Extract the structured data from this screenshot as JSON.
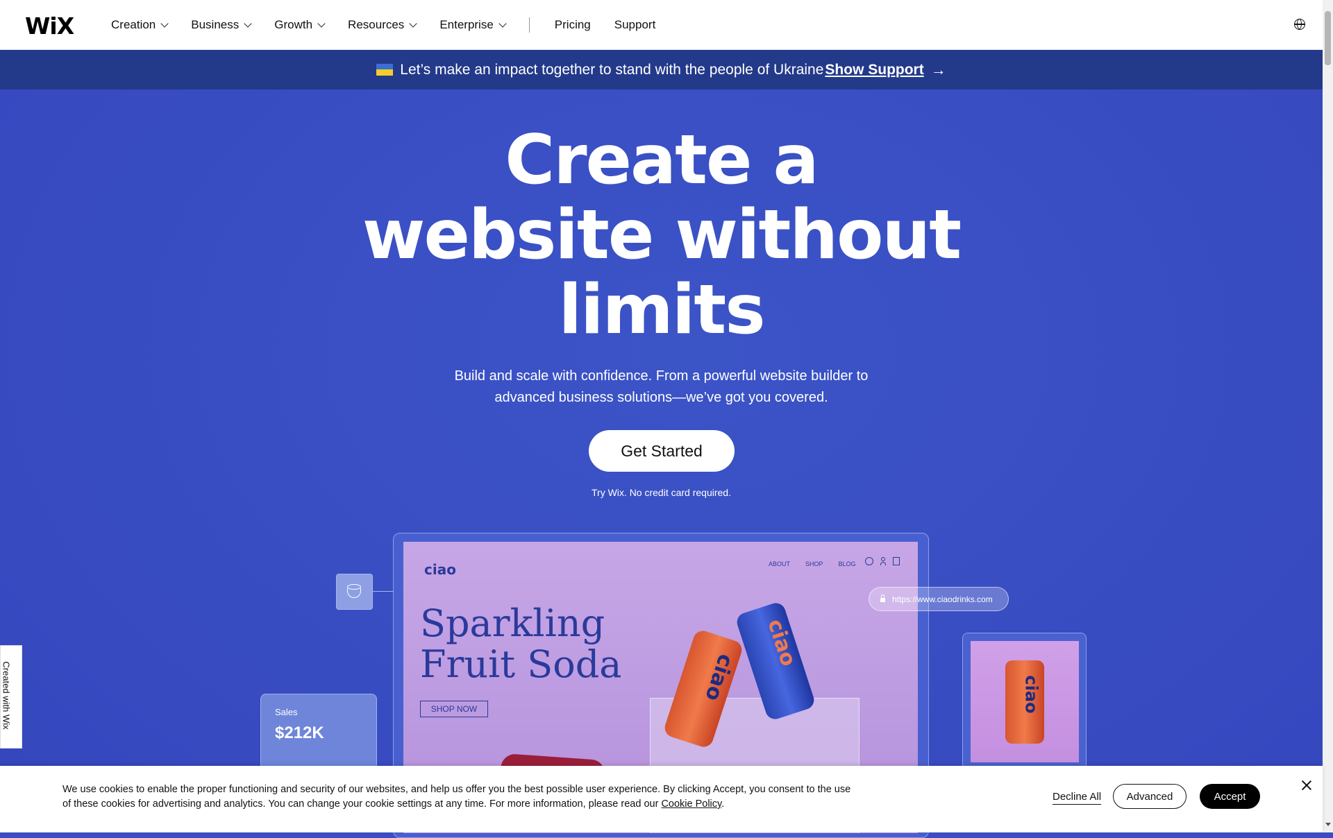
{
  "nav": {
    "logo": "WiX",
    "items": [
      {
        "label": "Creation",
        "dropdown": true
      },
      {
        "label": "Business",
        "dropdown": true
      },
      {
        "label": "Growth",
        "dropdown": true
      },
      {
        "label": "Resources",
        "dropdown": true
      },
      {
        "label": "Enterprise",
        "dropdown": true
      }
    ],
    "links": [
      "Pricing",
      "Support"
    ],
    "language_icon": "globe-icon"
  },
  "banner": {
    "text": "Let’s make an impact together to stand with the people of Ukraine",
    "link": "Show Support",
    "arrow": "→"
  },
  "hero": {
    "headline_line1": "Create a",
    "headline_line2": "website without",
    "headline_line3": "limits",
    "subtext_line1": "Build and scale with confidence. From a powerful website builder to",
    "subtext_line2": "advanced business solutions—we’ve got you covered.",
    "cta": "Get Started",
    "note": "Try Wix. No credit card required."
  },
  "showcase": {
    "brand": "ciao",
    "site_nav": [
      "ABOUT",
      "SHOP",
      "BLOG"
    ],
    "title_line1": "Sparkling",
    "title_line2": "Fruit Soda",
    "shop_button": "SHOP NOW",
    "can_label": "ciao",
    "url": "https://www.ciaodrinks.com",
    "sales_label": "Sales",
    "sales_value": "$212K"
  },
  "side_tab": {
    "text": "Created with Wix"
  },
  "cookie": {
    "text": "We use cookies to enable the proper functioning and security of our websites, and help us offer you the best possible user experience. By clicking Accept, you consent to the use of these cookies for advertising and analytics. You can change your cookie settings at any time. For more information, please read our",
    "policy_link": "Cookie Policy",
    "decline": "Decline All",
    "advanced": "Advanced",
    "accept": "Accept"
  },
  "colors": {
    "hero_bg": "#3a4fc4",
    "banner_bg": "#233a8a",
    "brand_text": "#2a3a9a"
  }
}
